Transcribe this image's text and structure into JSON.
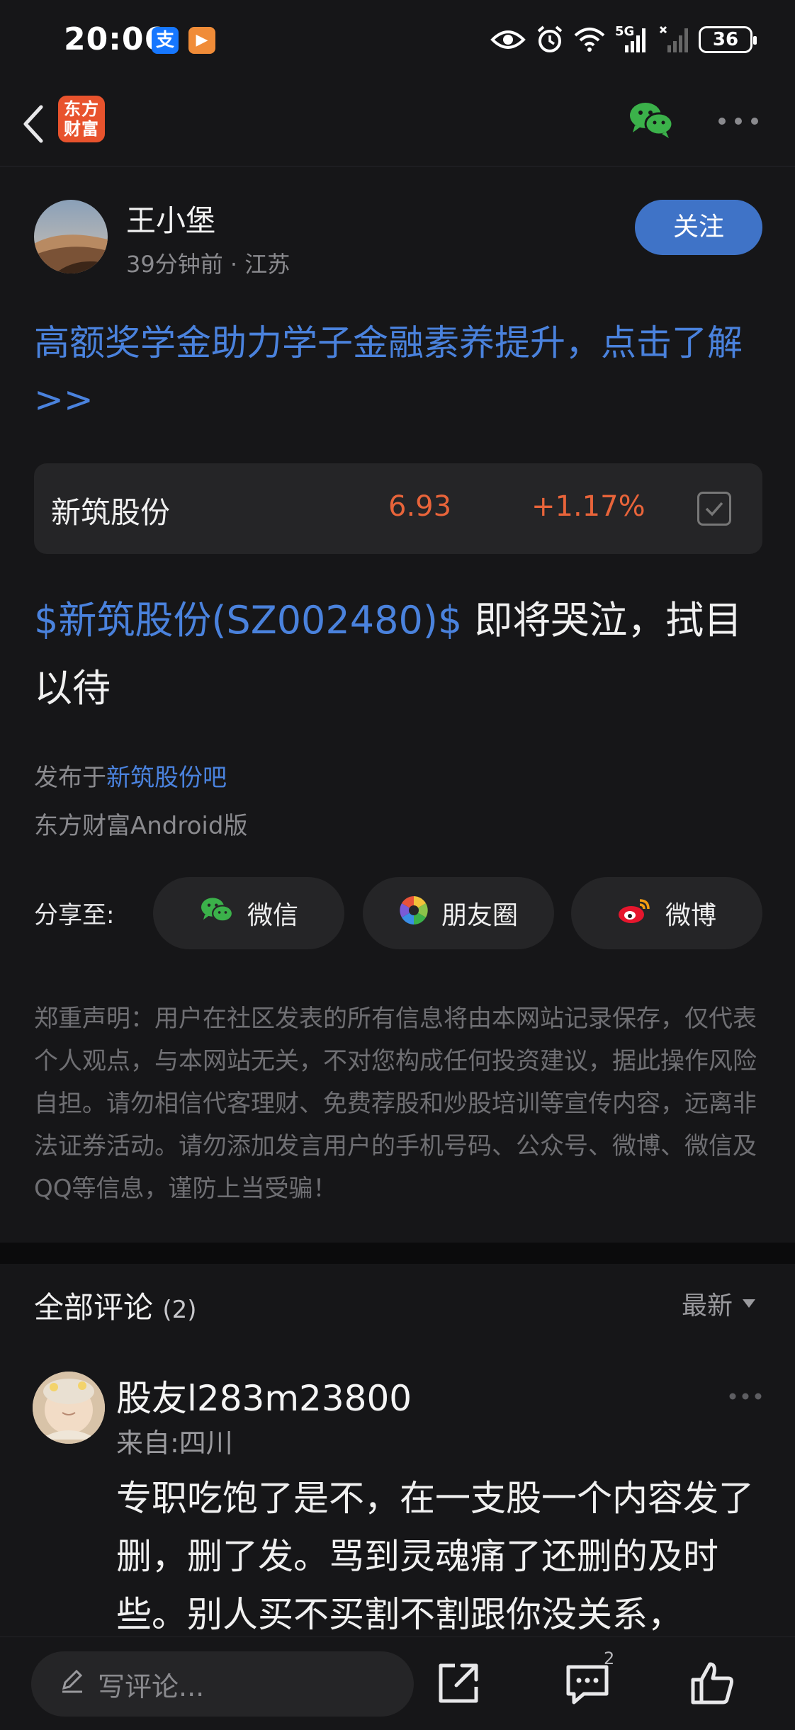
{
  "status_bar": {
    "time": "20:06",
    "app_icons": [
      {
        "name": "alipay-icon",
        "glyph": "支",
        "color": "#1677ff"
      },
      {
        "name": "play-app-icon",
        "glyph": "▶",
        "color": "#f08c38"
      }
    ],
    "network_label": "5G",
    "battery": "36"
  },
  "nav": {
    "logo_text": "东方财富",
    "logo_color": "#e8532d"
  },
  "author": {
    "name": "王小堡",
    "meta": "39分钟前 · 江苏",
    "follow_label": "关注"
  },
  "promo_link": "高额奖学金助力学子金融素养提升，点击了解>>",
  "stock": {
    "name": "新筑股份",
    "price": "6.93",
    "change": "+1.17%",
    "up_color": "#e8643a"
  },
  "post": {
    "tag": "$新筑股份(SZ002480)$",
    "text": " 即将哭泣，拭目以待"
  },
  "posted_in": {
    "prefix": "发布于",
    "bar_name": "新筑股份吧"
  },
  "client": "东方财富Android版",
  "share": {
    "label": "分享至:",
    "buttons": [
      {
        "label": "微信",
        "icon": "wechat-icon"
      },
      {
        "label": "朋友圈",
        "icon": "moments-icon"
      },
      {
        "label": "微博",
        "icon": "weibo-icon"
      }
    ]
  },
  "disclaimer": "郑重声明：用户在社区发表的所有信息将由本网站记录保存，仅代表个人观点，与本网站无关，不对您构成任何投资建议，据此操作风险自担。请勿相信代客理财、免费荐股和炒股培训等宣传内容，远离非法证券活动。请勿添加发言用户的手机号码、公众号、微博、微信及QQ等信息，谨防上当受骗！",
  "comments": {
    "title": "全部评论",
    "count": "(2)",
    "sort_label": "最新",
    "items": [
      {
        "user": "股友l283m23800",
        "from": "来自:四川",
        "text": "专职吃饱了是不，在一支股一个内容发了删，删了发。骂到灵魂痛了还删的及时些。别人买不买割不割跟你没关系，"
      }
    ]
  },
  "bottom": {
    "comment_placeholder": "写评论...",
    "comment_badge": "2"
  }
}
